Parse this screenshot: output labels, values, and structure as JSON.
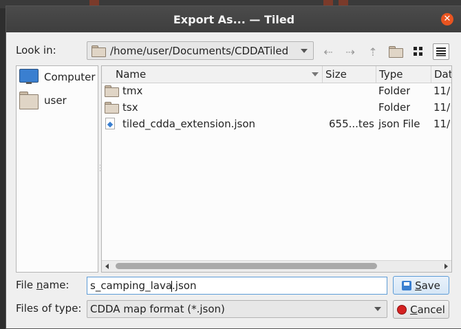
{
  "window": {
    "title": "Export As... — Tiled"
  },
  "look_in": {
    "label": "Look in:",
    "path": "/home/user/Documents/CDDATiled"
  },
  "toolbar": {
    "back_icon": "arrow-left-icon",
    "forward_icon": "arrow-right-icon",
    "parent_icon": "arrow-up-icon",
    "new_folder_icon": "new-folder-icon",
    "list_view_icon": "list-view-icon",
    "detail_view_icon": "detail-view-icon"
  },
  "sidebar": {
    "items": [
      {
        "label": "Computer",
        "icon": "computer-icon"
      },
      {
        "label": "user",
        "icon": "folder-icon"
      }
    ]
  },
  "files": {
    "columns": [
      "Name",
      "Size",
      "Type",
      "Dat"
    ],
    "rows": [
      {
        "name": "tmx",
        "size": "",
        "type": "Folder",
        "date": "11/",
        "icon": "folder-icon"
      },
      {
        "name": "tsx",
        "size": "",
        "type": "Folder",
        "date": "11/",
        "icon": "folder-icon"
      },
      {
        "name": "tiled_cdda_extension.json",
        "size": "655...tes",
        "type": "json File",
        "date": "11/",
        "icon": "json-file-icon"
      }
    ]
  },
  "file_name": {
    "label_prefix": "File ",
    "label_underlined": "n",
    "label_suffix": "ame:",
    "value_before_caret": "s_camping_lava",
    "value_after_caret": ".json"
  },
  "file_type": {
    "label": "Files of type:",
    "selected": "CDDA map format (*.json)"
  },
  "buttons": {
    "save_underlined": "S",
    "save_rest": "ave",
    "cancel_underlined": "C",
    "cancel_rest": "ancel"
  },
  "colors": {
    "accent": "#e95420",
    "selection": "#5c9bd6"
  }
}
